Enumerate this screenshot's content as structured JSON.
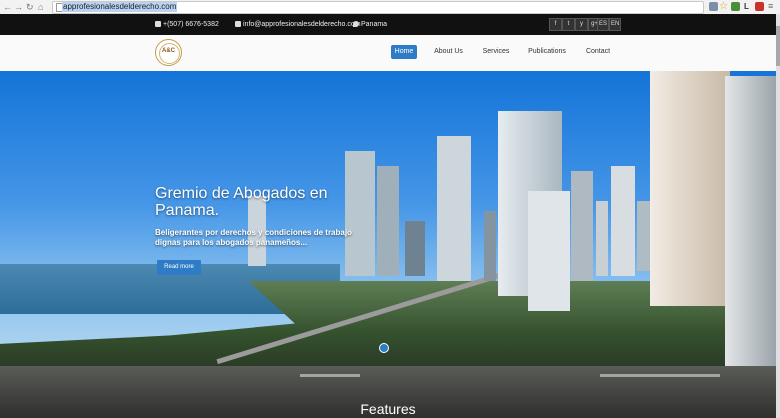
{
  "browser": {
    "url": "approfesionalesdelderecho.com",
    "nav_icons": [
      "back-icon",
      "forward-icon",
      "reload-icon",
      "home-icon"
    ],
    "extension_icons": [
      "translate-icon",
      "bookmark-star-icon",
      "extension-icon",
      "profile-letter-icon",
      "extension-badge-icon",
      "menu-icon"
    ],
    "profile_letter": "L"
  },
  "topbar": {
    "phone": "+(507) 6676-5382",
    "email": "info@approfesionalesdelderecho.com",
    "location": "Panama",
    "social": [
      "f",
      "t",
      "y",
      "g+"
    ],
    "lang": [
      "ES",
      "EN"
    ]
  },
  "header": {
    "logo_text": "A&C",
    "menu": [
      {
        "label": "Home",
        "active": true
      },
      {
        "label": "About Us",
        "active": false
      },
      {
        "label": "Services",
        "active": false
      },
      {
        "label": "Publications",
        "active": false
      },
      {
        "label": "Contact",
        "active": false
      }
    ]
  },
  "hero": {
    "title": "Gremio de Abogados en Panama.",
    "subtitle": "Beligerantes por derechos y condiciones de trabajo dignas para los abogados panameños...",
    "button": "Read more"
  },
  "features": {
    "title": "Features"
  },
  "colors": {
    "accent": "#2e7cc6",
    "topbar": "#111111"
  }
}
